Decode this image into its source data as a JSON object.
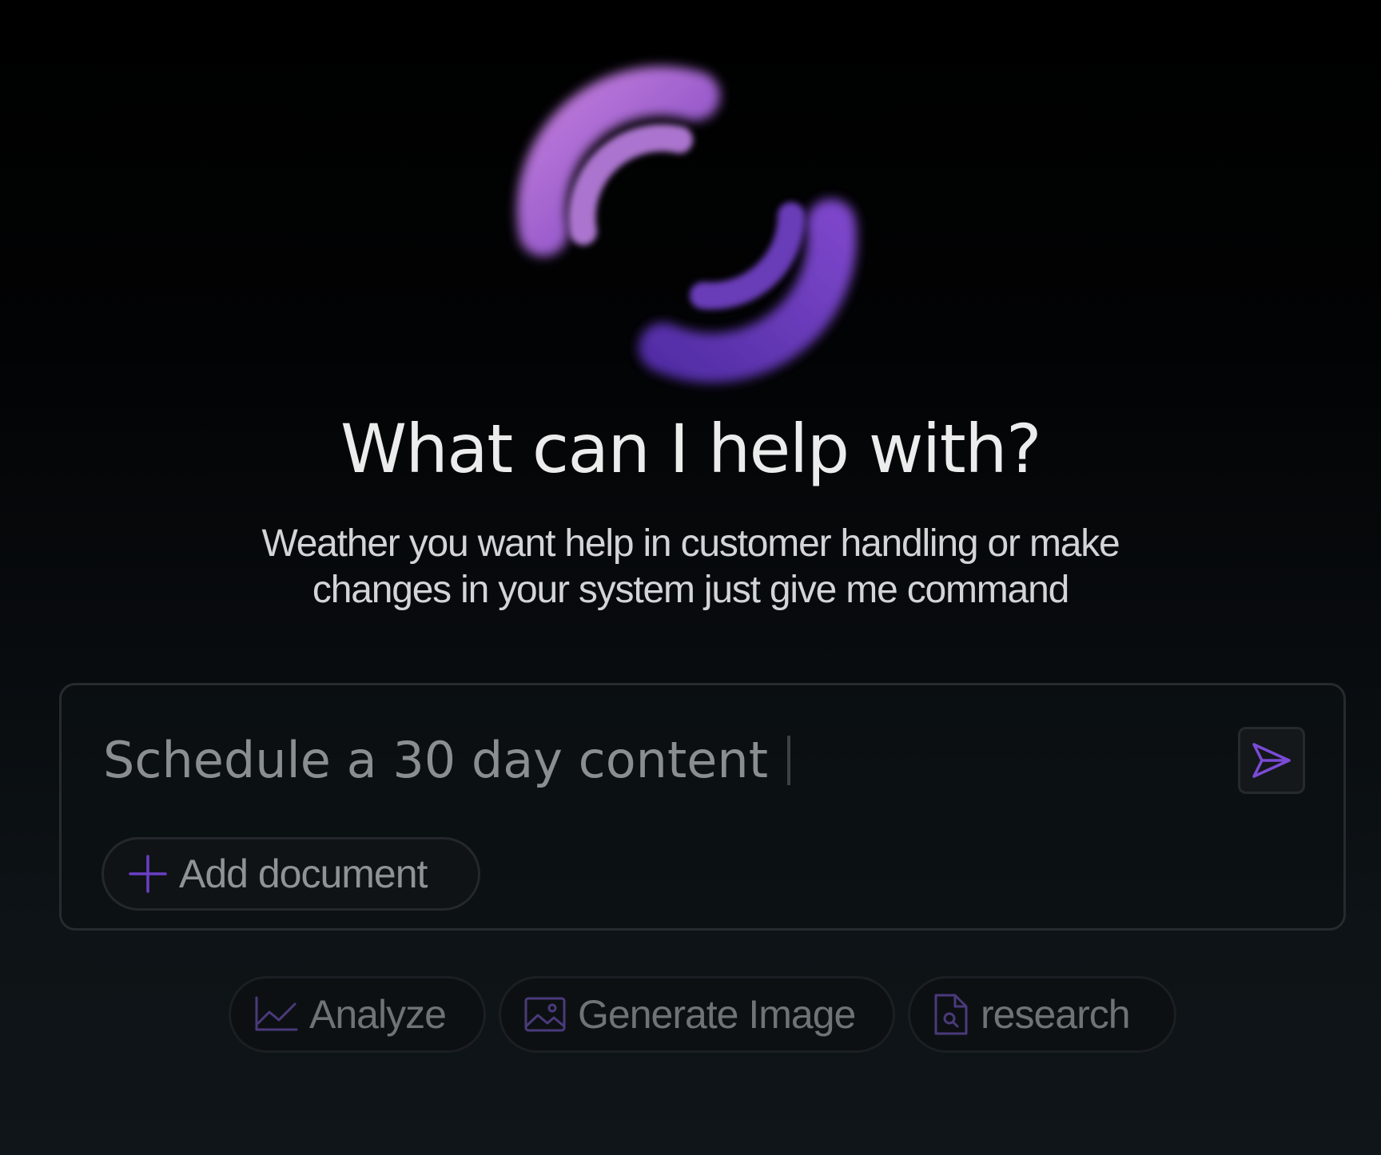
{
  "hero": {
    "orb_icon": "spinning-arcs-orb",
    "title": "What can I help with?",
    "subtitle_line1": "Weather you want help in  customer handling or make",
    "subtitle_line2": "changes in your system just give me command"
  },
  "composer": {
    "input_value": "Schedule a 30 day content",
    "send_icon": "send-icon",
    "add_document_label": "Add document",
    "add_icon": "plus-icon"
  },
  "actions": [
    {
      "label": "Analyze",
      "icon": "chart-line-icon"
    },
    {
      "label": "Generate Image",
      "icon": "image-icon"
    },
    {
      "label": "research",
      "icon": "file-search-icon"
    }
  ],
  "colors": {
    "accent": "#7b4bd6",
    "orb_light": "#c77bf0",
    "orb_dark": "#6f3fd0"
  }
}
